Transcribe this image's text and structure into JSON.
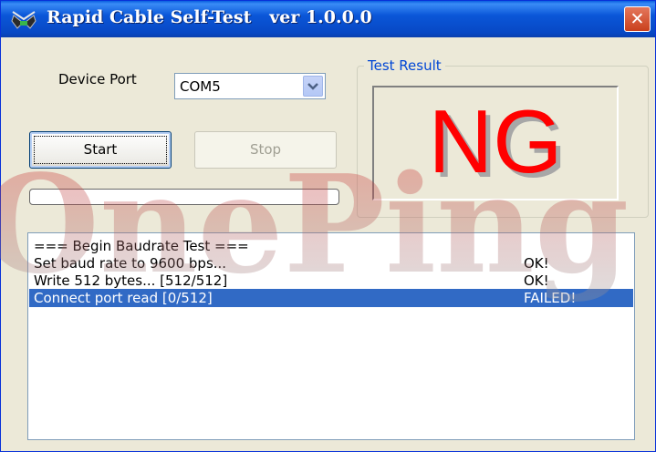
{
  "window": {
    "title": "Rapid Cable Self-Test   ver 1.0.0.0",
    "close_label": "✕"
  },
  "device": {
    "label": "Device Port",
    "selected_port": "COM5"
  },
  "buttons": {
    "start_label": "Start",
    "stop_label": "Stop"
  },
  "progress": {
    "value_percent": 0
  },
  "test_result": {
    "group_title": "Test Result",
    "value": "NG",
    "value_color": "#ff0000"
  },
  "log": {
    "rows": [
      {
        "message": "=== Begin Baudrate Test ===",
        "status": ""
      },
      {
        "message": "Set baud rate to 9600 bps...",
        "status": "OK!"
      },
      {
        "message": "Write 512 bytes... [512/512]",
        "status": "OK!"
      },
      {
        "message": "Connect port read [0/512]",
        "status": "FAILED!"
      }
    ],
    "selected_index": 3
  },
  "watermark": {
    "text": "OnePing"
  },
  "colors": {
    "titlebar_blue": "#0a56d8",
    "selection_blue": "#316ac5",
    "group_title_blue": "#0046d5",
    "window_face": "#ece9d8"
  }
}
